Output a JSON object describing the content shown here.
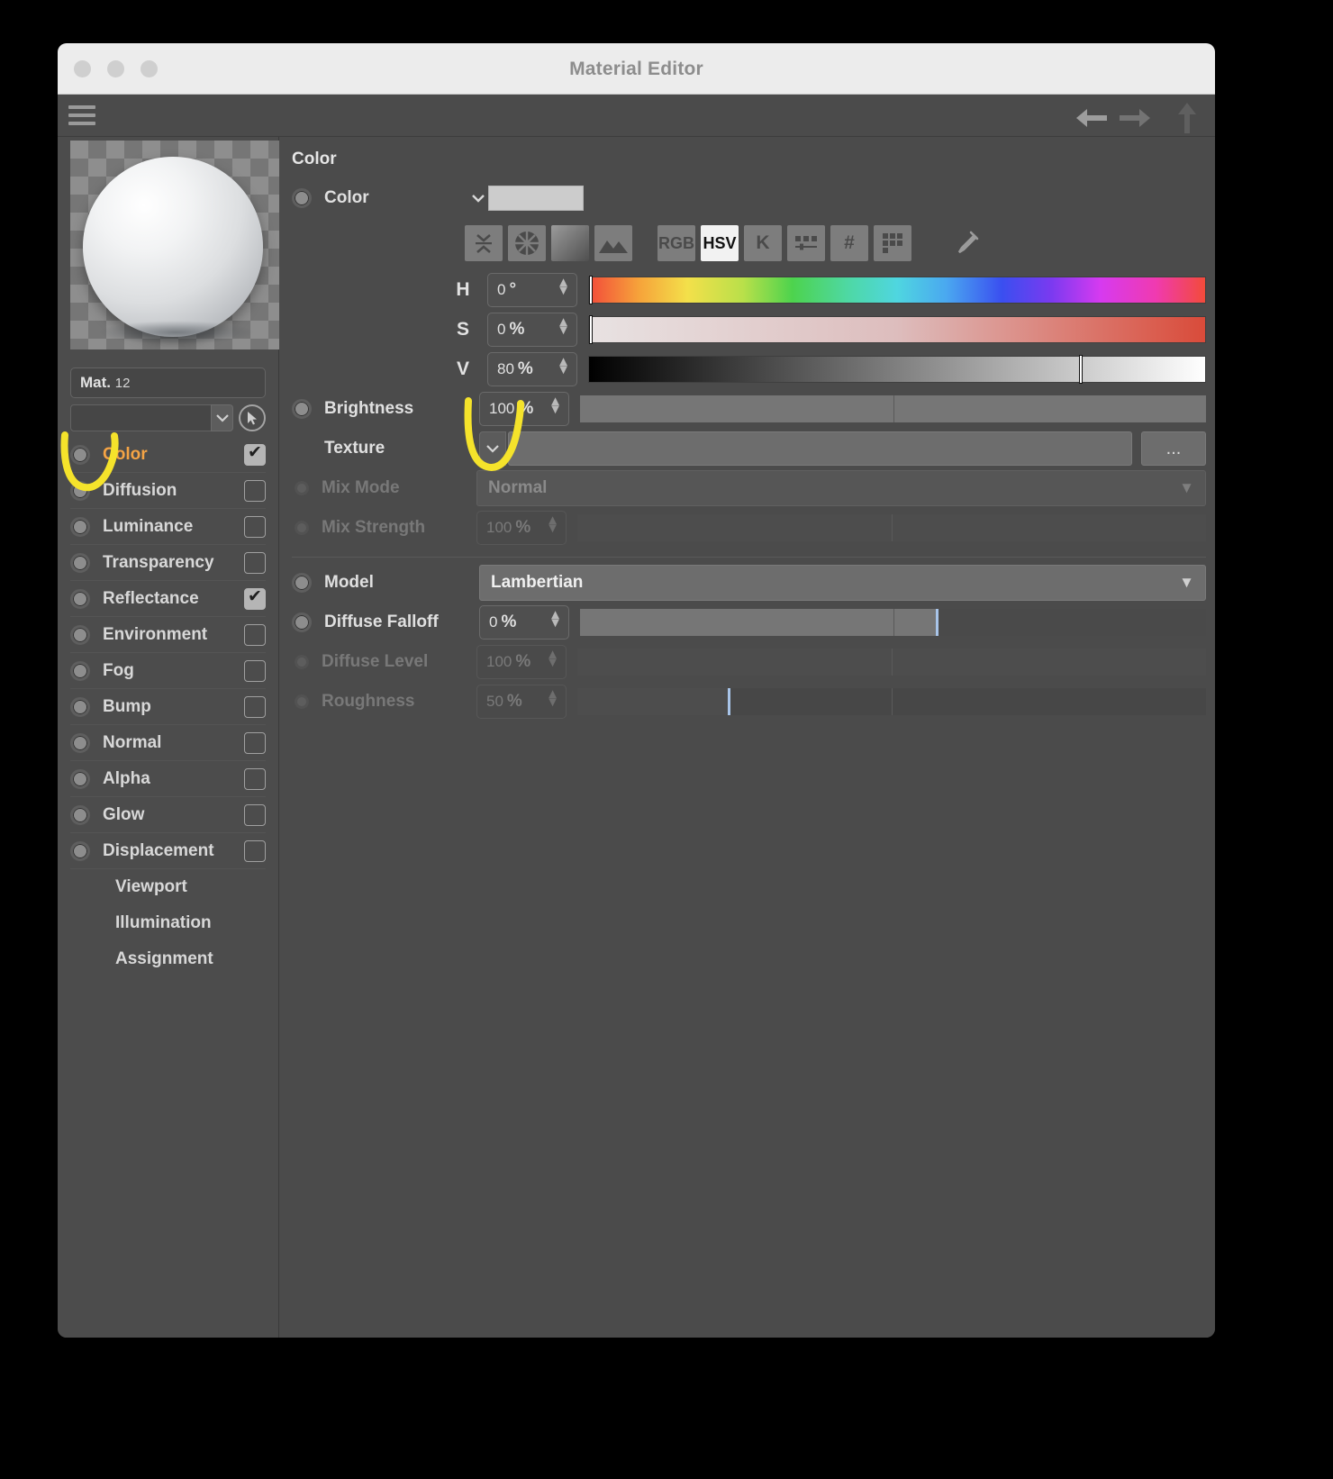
{
  "window": {
    "title": "Material Editor",
    "traffic_lights": [
      "close-button",
      "minimize-button",
      "zoom-button"
    ]
  },
  "toolbar": {
    "menu_icon": "hamburger-menu-icon",
    "back_icon": "arrow-left-icon",
    "forward_icon": "arrow-right-icon",
    "up_icon": "arrow-up-icon"
  },
  "sidebar": {
    "preview_label": "material-preview-sphere",
    "material_name": "Mat.",
    "material_number": "12",
    "search_value": "",
    "dropdown_icon": "chevron-down-icon",
    "picker_icon": "pointer-select-icon",
    "channels": [
      {
        "label": "Color",
        "enabled": true,
        "active": true,
        "has_radio": true
      },
      {
        "label": "Diffusion",
        "enabled": false,
        "active": false,
        "has_radio": true
      },
      {
        "label": "Luminance",
        "enabled": false,
        "active": false,
        "has_radio": true
      },
      {
        "label": "Transparency",
        "enabled": false,
        "active": false,
        "has_radio": true
      },
      {
        "label": "Reflectance",
        "enabled": true,
        "active": false,
        "has_radio": true
      },
      {
        "label": "Environment",
        "enabled": false,
        "active": false,
        "has_radio": true
      },
      {
        "label": "Fog",
        "enabled": false,
        "active": false,
        "has_radio": true
      },
      {
        "label": "Bump",
        "enabled": false,
        "active": false,
        "has_radio": true
      },
      {
        "label": "Normal",
        "enabled": false,
        "active": false,
        "has_radio": true
      },
      {
        "label": "Alpha",
        "enabled": false,
        "active": false,
        "has_radio": true
      },
      {
        "label": "Glow",
        "enabled": false,
        "active": false,
        "has_radio": true
      },
      {
        "label": "Displacement",
        "enabled": false,
        "active": false,
        "has_radio": true
      }
    ],
    "pages": [
      "Viewport",
      "Illumination",
      "Assignment"
    ]
  },
  "main": {
    "section_title": "Color",
    "color_row": {
      "label": "Color",
      "chevron_icon": "chevron-down-icon",
      "swatch_hex": "#CCCCCC"
    },
    "picker_tools": [
      {
        "name": "collapse-expand-icon",
        "label": "",
        "selected": false
      },
      {
        "name": "color-wheel-icon",
        "label": "",
        "selected": false
      },
      {
        "name": "gradient-icon",
        "label": "",
        "selected": false
      },
      {
        "name": "image-picker-icon",
        "label": "",
        "selected": false
      },
      {
        "name": "rgb-mode-button",
        "label": "RGB",
        "selected": false
      },
      {
        "name": "hsv-mode-button",
        "label": "HSV",
        "selected": true
      },
      {
        "name": "kelvin-mode-button",
        "label": "K",
        "selected": false
      },
      {
        "name": "sliders-mode-button",
        "label": "",
        "selected": false
      },
      {
        "name": "hex-mode-button",
        "label": "#",
        "selected": false
      },
      {
        "name": "swatches-mode-button",
        "label": "",
        "selected": false
      },
      {
        "name": "eyedropper-icon",
        "label": "",
        "selected": false
      }
    ],
    "hsv": [
      {
        "label": "H",
        "value": "0",
        "unit": "°",
        "percent": 0
      },
      {
        "label": "S",
        "value": "0",
        "unit": "%",
        "percent": 0
      },
      {
        "label": "V",
        "value": "80",
        "unit": "%",
        "percent": 80
      }
    ],
    "params": [
      {
        "name": "brightness",
        "label": "Brightness",
        "value": "100",
        "unit": "%",
        "percent": 100,
        "disabled": false,
        "type": "slider"
      },
      {
        "name": "texture",
        "label": "Texture",
        "value": "",
        "unit": "",
        "percent": 0,
        "disabled": false,
        "type": "texture",
        "more_label": "..."
      },
      {
        "name": "mix-mode",
        "label": "Mix Mode",
        "value": "Normal",
        "unit": "",
        "percent": 0,
        "disabled": true,
        "type": "combo"
      },
      {
        "name": "mix-strength",
        "label": "Mix Strength",
        "value": "100",
        "unit": "%",
        "percent": 100,
        "disabled": true,
        "type": "slider"
      },
      {
        "name": "model",
        "label": "Model",
        "value": "Lambertian",
        "unit": "",
        "percent": 0,
        "disabled": false,
        "type": "combo"
      },
      {
        "name": "diffuse-falloff",
        "label": "Diffuse Falloff",
        "value": "0",
        "unit": "%",
        "percent": 57,
        "disabled": false,
        "type": "slider"
      },
      {
        "name": "diffuse-level",
        "label": "Diffuse Level",
        "value": "100",
        "unit": "%",
        "percent": 100,
        "disabled": true,
        "type": "slider"
      },
      {
        "name": "roughness",
        "label": "Roughness",
        "value": "50",
        "unit": "%",
        "percent": 24,
        "disabled": true,
        "type": "slider"
      }
    ]
  },
  "annotations": [
    {
      "name": "yellow-mark-color-channel",
      "color": "#F5E32B"
    },
    {
      "name": "yellow-mark-brightness-texture",
      "color": "#F5E32B"
    }
  ]
}
